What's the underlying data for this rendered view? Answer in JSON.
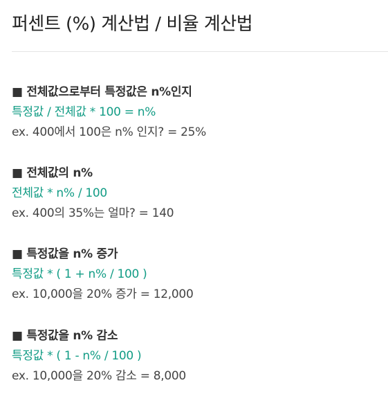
{
  "page": {
    "title": "퍼센트 (%) 계산법 / 비율 계산법"
  },
  "sections": [
    {
      "heading": "■ 전체값으로부터 특정값은 n%인지",
      "formula": "특정값 / 전체값 * 100 = n%",
      "example": "ex. 400에서 100은 n% 인지? = 25%"
    },
    {
      "heading": "■ 전체값의 n%",
      "formula": "전체값 * n% / 100",
      "example": "ex. 400의 35%는 얼마? = 140"
    },
    {
      "heading": "■ 특정값을 n% 증가",
      "formula": "특정값 * ( 1 + n% / 100 )",
      "example": "ex. 10,000을 20% 증가 = 12,000"
    },
    {
      "heading": "■ 특정값을 n% 감소",
      "formula": "특정값 * ( 1 - n% / 100 )",
      "example": "ex. 10,000을 20% 감소 = 8,000"
    }
  ],
  "colors": {
    "formula": "#129c85",
    "text": "#333333",
    "divider": "#e4e4e4"
  }
}
